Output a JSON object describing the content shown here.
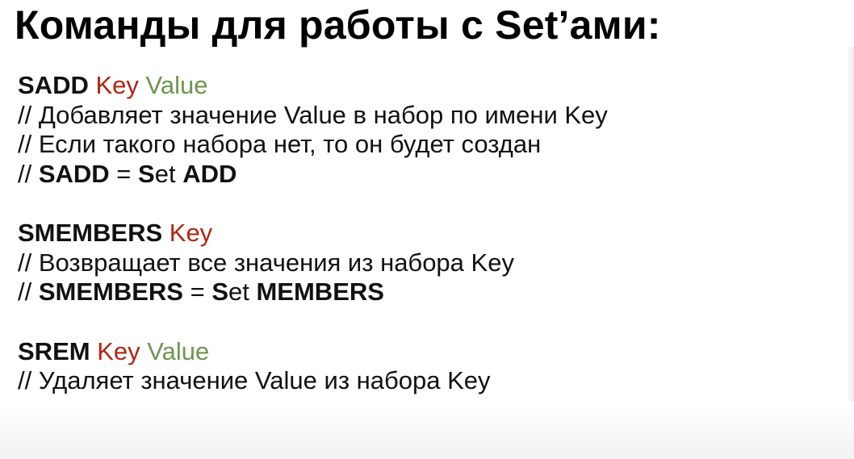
{
  "title": "Команды для работы с Set’ами:",
  "blocks": {
    "sadd": {
      "command": "SADD",
      "key": "Key",
      "value": "Value",
      "comment1": "// Добавляет значение Value в набор по имени Key",
      "comment2": "// Если такого набора нет, то он будет создан",
      "expansion": {
        "prefix": "// ",
        "cmd": "SADD",
        "equals": " = ",
        "first_letter": "S",
        "rest": "et ",
        "word": "ADD"
      }
    },
    "smembers": {
      "command": "SMEMBERS",
      "key": "Key",
      "comment1": "// Возвращает все значения из набора Key",
      "expansion": {
        "prefix": "// ",
        "cmd": "SMEMBERS",
        "equals": " = ",
        "first_letter": "S",
        "rest": "et ",
        "word": "MEMBERS"
      }
    },
    "srem": {
      "command": "SREM",
      "key": "Key",
      "value": "Value",
      "comment1": "// Удаляет значение Value из набора Key"
    }
  },
  "colors": {
    "key": "#b32414",
    "value": "#6f9650",
    "text": "#111111"
  }
}
